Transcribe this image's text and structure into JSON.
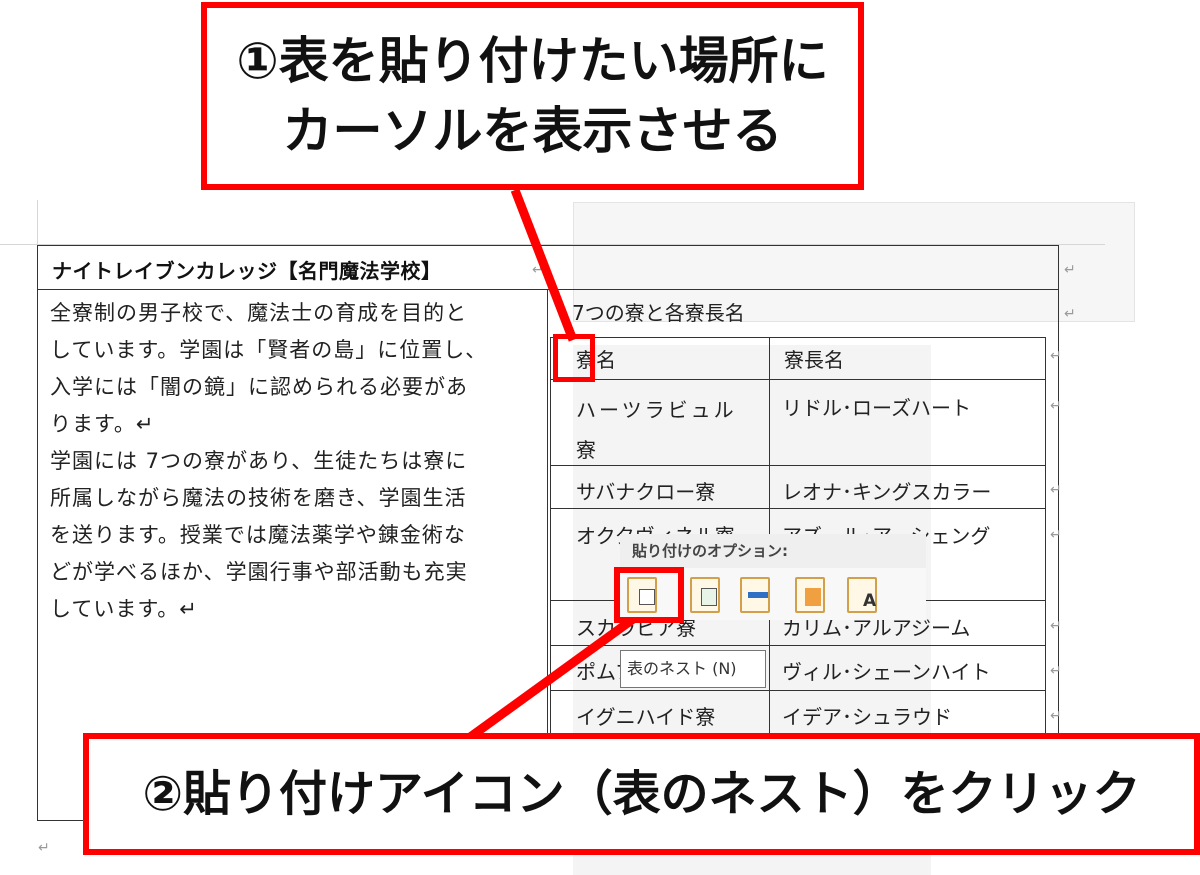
{
  "callout_top": {
    "line1": "①表を貼り付けたい場所に",
    "line2": "カーソルを表示させる"
  },
  "callout_bottom": {
    "text": "②貼り付けアイコン（表のネスト）をクリック"
  },
  "document": {
    "title": "ナイトレイブンカレッジ【名門魔法学校】",
    "description": "全寮制の男子校で、魔法士の育成を目的と\nしています。学園は「賢者の島」に位置し、\n入学には「闇の鏡」に認められる必要があ\nります。↵\n学園には 7つの寮があり、生徒たちは寮に\n所属しながら魔法の技術を磨き、学園生活\nを送ります。授業では魔法薬学や錬金術な\nどが学べるほか、学園行事や部活動も充実\nしています。↵",
    "right_label": "7つの寮と各寮長名",
    "paragraph_mark": "↵",
    "table": {
      "headers": [
        "寮名",
        "寮長名"
      ],
      "rows": [
        [
          "ハーツラビュル寮",
          "リドル･ローズハート"
        ],
        [
          "サバナクロー寮",
          "レオナ･キングスカラー"
        ],
        [
          "オクタヴィネル寮",
          "アズール･アーシェング"
        ],
        [
          "スカラビア寮",
          "カリム･アルアジーム"
        ],
        [
          "ポムフィオーレ寮",
          "ヴィル･シェーンハイト"
        ],
        [
          "イグニハイド寮",
          "イデア･シュラウド"
        ]
      ]
    }
  },
  "paste_options": {
    "header": "貼り付けのオプション:",
    "icons": [
      "paste-nest-table-icon",
      "paste-merge-table-icon",
      "paste-insert-rows-icon",
      "paste-overwrite-cells-icon",
      "paste-text-only-icon"
    ],
    "tooltip": "表のネスト (N)",
    "text_icon_glyph": "A"
  },
  "colors": {
    "callout_border": "#ff0000",
    "icon_clipboard": "#d2a04a"
  }
}
